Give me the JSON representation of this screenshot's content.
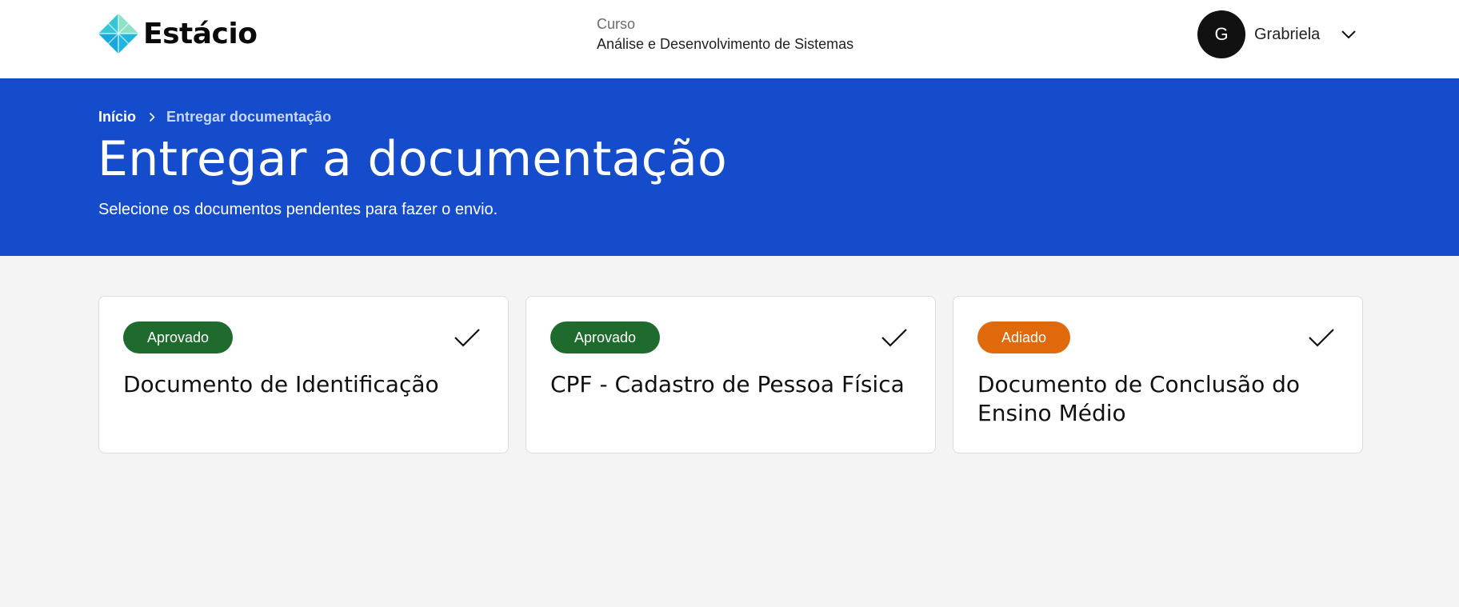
{
  "header": {
    "logo_text": "Estácio",
    "course_label": "Curso",
    "course_name": "Análise e Desenvolvimento de Sistemas",
    "user": {
      "initial": "G",
      "name": "Grabriela"
    }
  },
  "banner": {
    "breadcrumb": {
      "home": "Início",
      "current": "Entregar documentação"
    },
    "title": "Entregar a documentação",
    "subtitle": "Selecione os documentos pendentes para fazer o envio."
  },
  "cards": [
    {
      "status": "Aprovado",
      "status_color": "#1f6b2d",
      "title": "Documento de Identificação"
    },
    {
      "status": "Aprovado",
      "status_color": "#1f6b2d",
      "title": "CPF - Cadastro de Pessoa Física"
    },
    {
      "status": "Adiado",
      "status_color": "#e0690b",
      "title": "Documento de Conclusão do Ensino Médio"
    }
  ],
  "colors": {
    "banner": "#154ccb",
    "approved": "#1f6b2d",
    "postponed": "#e0690b",
    "page_bg": "#f4f4f4"
  },
  "icons": {
    "logo": "estacio-logo-icon",
    "user_menu": "chevron-down-icon",
    "breadcrumb_separator": "chevron-right-icon",
    "card_status": "checkmark-icon"
  }
}
